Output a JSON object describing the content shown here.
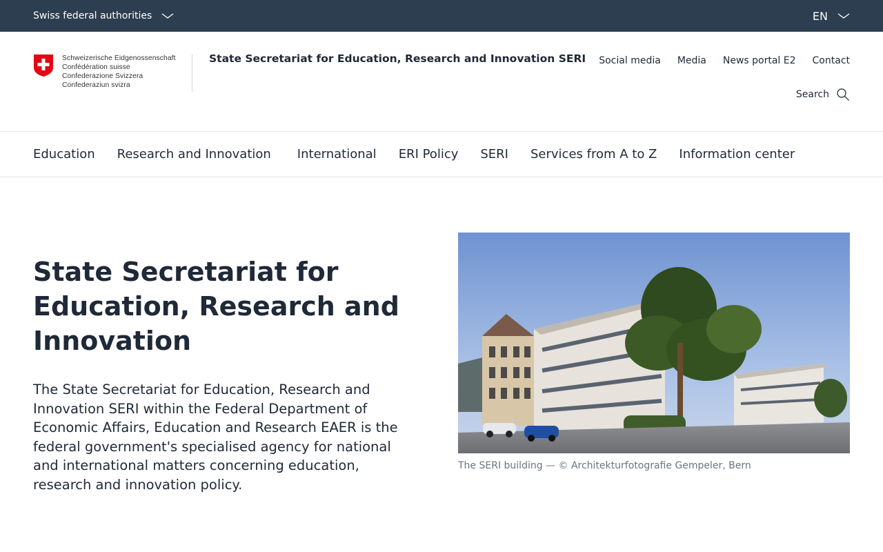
{
  "topbar": {
    "federal_label": "Swiss federal authorities",
    "language": "EN"
  },
  "header": {
    "confederation_lines": [
      "Schweizerische Eidgenossenschaft",
      "Confédération suisse",
      "Confederazione Svizzera",
      "Confederaziun svizra"
    ],
    "department_title": "State Secretariat for Education, Research and Innovation SERI",
    "service_nav": [
      "Social media",
      "Media",
      "News portal E2",
      "Contact"
    ],
    "search_label": "Search"
  },
  "main_nav": [
    "Education",
    "Research and Innovation",
    "International",
    "ERI Policy",
    "SERI",
    "Services from A to Z",
    "Information center"
  ],
  "hero": {
    "title": "State Secretariat for Education, Research and Innovation",
    "description": "The State Secretariat for Education, Research and Innovation SERI within the Federal Department of Economic Affairs, Education and Research EAER is the federal government's specialised agency for national and international matters concerning education, research and innovation policy.",
    "image_caption": "The SERI building — © Architekturfotografie Gempeler, Bern"
  },
  "colors": {
    "topbar_bg": "#2d3e50",
    "swiss_red": "#e30613",
    "text": "#1f2937",
    "caption": "#6b7280"
  },
  "icons": [
    "chevron-down-icon",
    "swiss-cross-icon",
    "search-icon"
  ]
}
